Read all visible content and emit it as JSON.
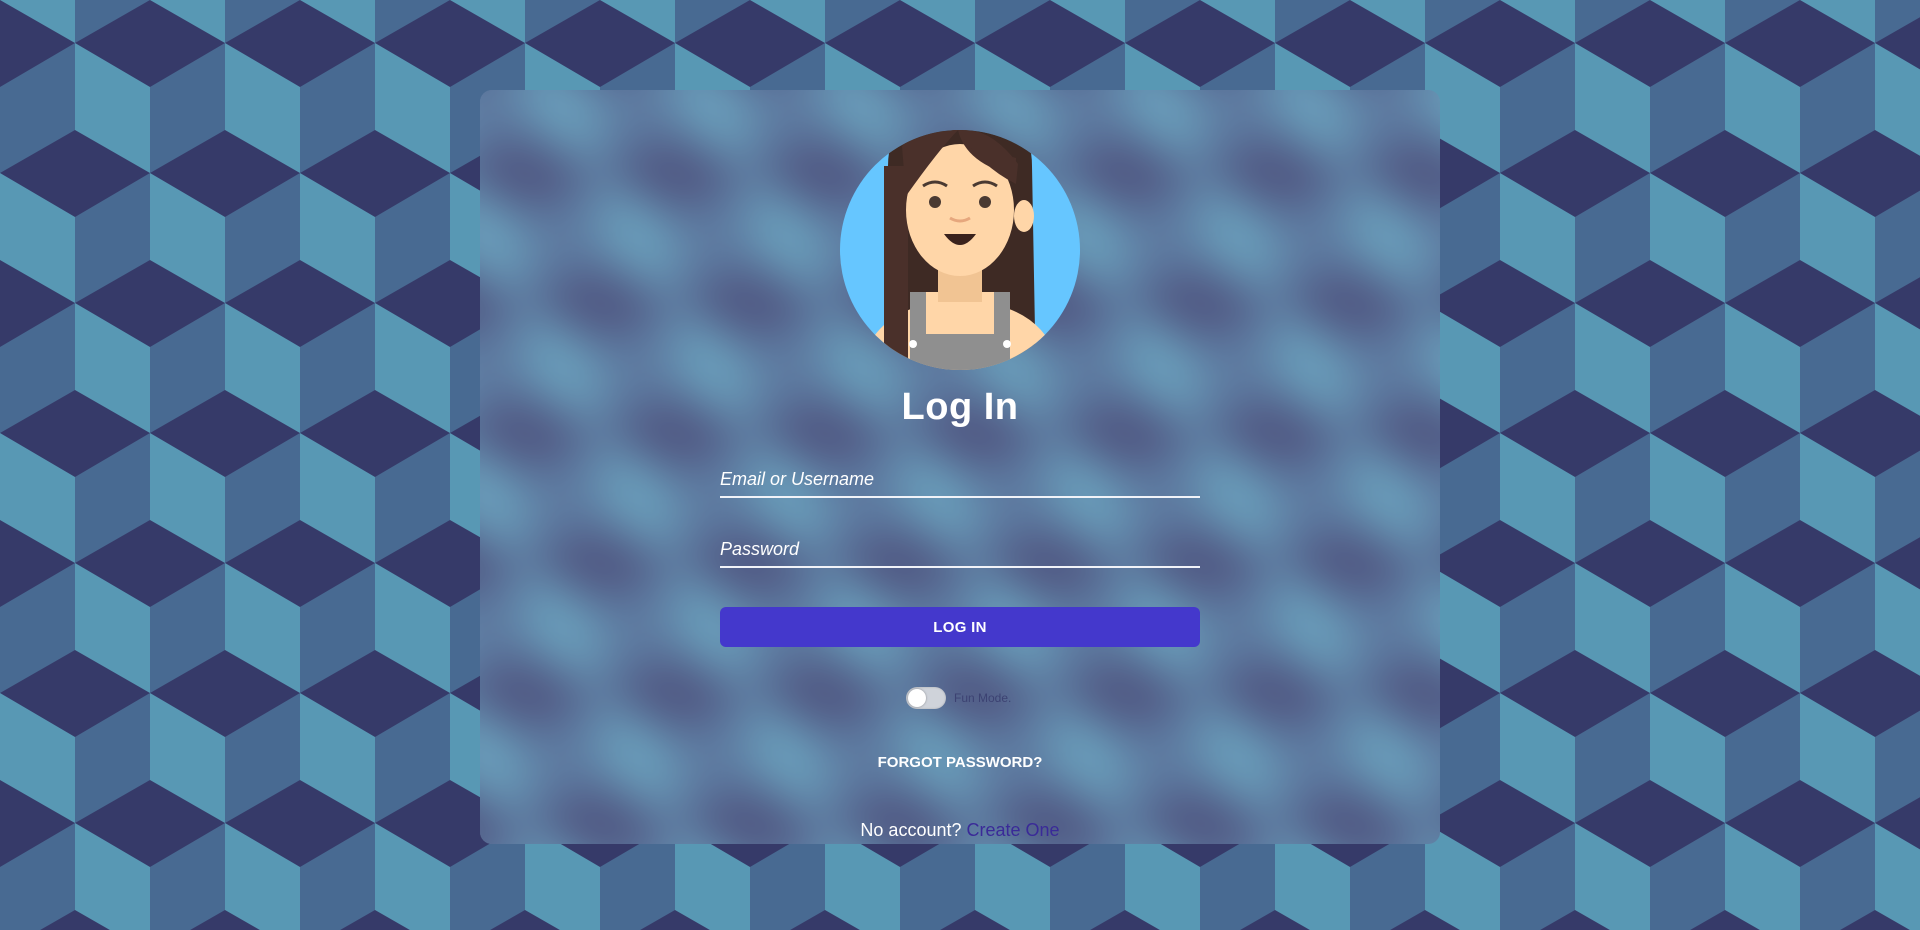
{
  "colors": {
    "background_dark": "#363a69",
    "background_mid": "#4a6890",
    "background_light": "#5898b4",
    "accent_button": "#4438cc",
    "link": "#3a2a98"
  },
  "avatar": {
    "icon": "user-avatar-woman-icon"
  },
  "login": {
    "title": "Log In",
    "email_placeholder": "Email or Username",
    "password_placeholder": "Password",
    "submit_label": "LOG IN",
    "fun_mode_label": "Fun Mode.",
    "fun_mode_on": false,
    "forgot_label": "FORGOT PASSWORD?",
    "no_account_text": "No account?",
    "create_link": "Create One"
  }
}
